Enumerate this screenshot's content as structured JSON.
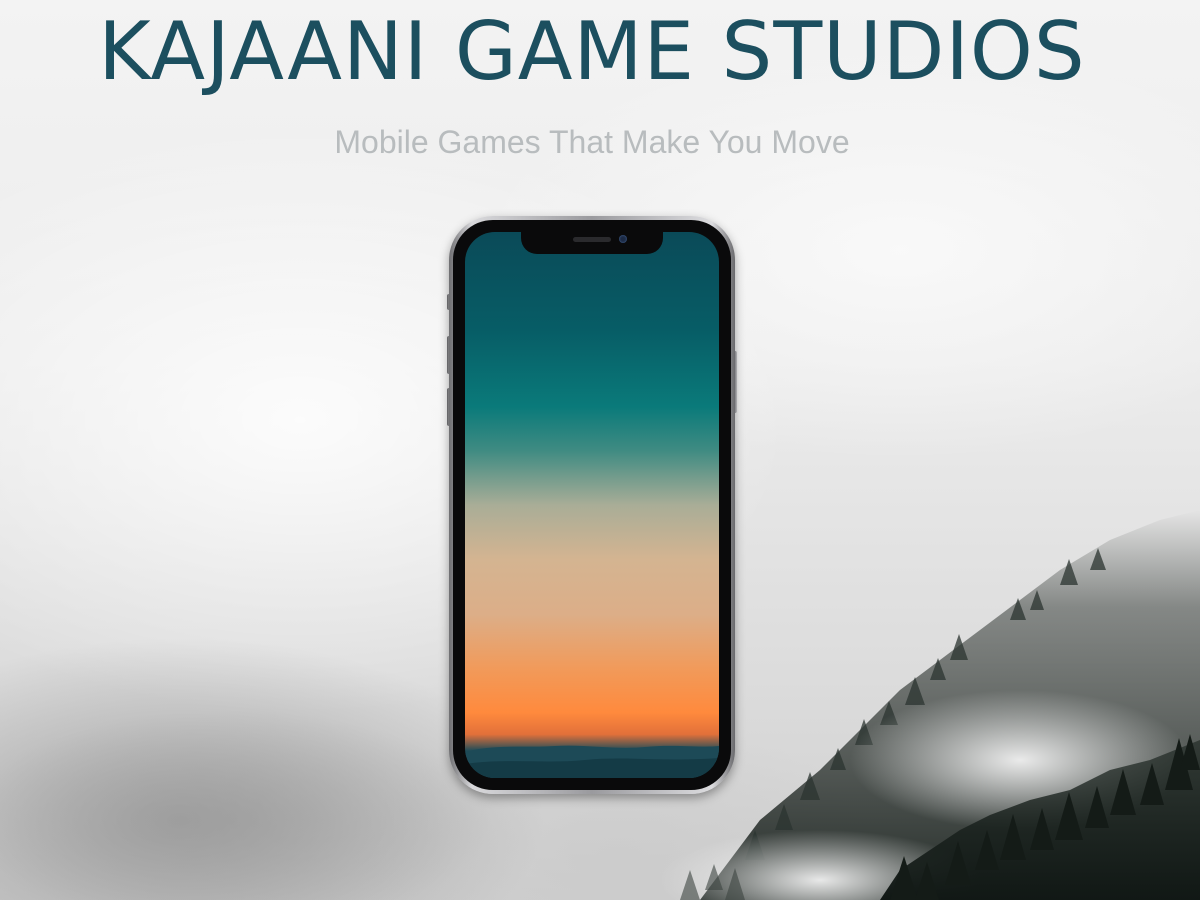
{
  "header": {
    "title": "KAJAANI GAME STUDIOS",
    "tagline": "Mobile Games That Make You Move"
  },
  "hero": {
    "background": "misty forested hillside",
    "device": "smartphone mockup with sunset gradient wallpaper"
  },
  "colors": {
    "title": "#1c4f5f",
    "tagline": "#b8bcbe",
    "mist": "#e9e9ea",
    "forest": "#1f2a24",
    "screen_top": "#0a4a58",
    "screen_middle": "#d4b491",
    "screen_bottom": "#ff8a3d"
  }
}
